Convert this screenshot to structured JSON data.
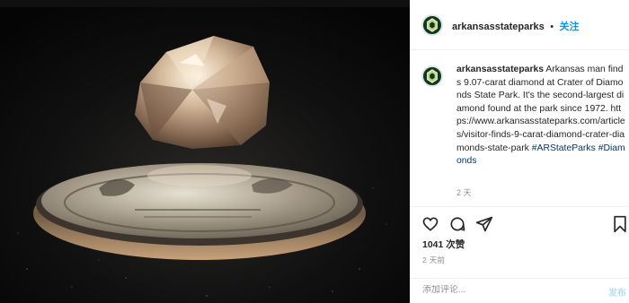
{
  "post": {
    "photo_alt": "Diamond on a coin",
    "header": {
      "username": "arkansasstateparks",
      "separator": "•",
      "follow_label": "关注"
    },
    "caption": {
      "username": "arkansasstateparks",
      "text": "Arkansas man finds 9.07-carat diamond at Crater of Diamonds State Park. It's the second-largest diamond found at the park since 1972. https://www.arkansasstateparks.com/articles/visitor-finds-9-carat-diamond-crater-diamonds-state-park",
      "hashtags": [
        "#ARStateParks",
        "#Diamonds"
      ],
      "time": "2 天"
    },
    "actions": {
      "icons": [
        "heart-icon",
        "comment-icon",
        "share-icon",
        "bookmark-icon"
      ]
    },
    "likes": "1041 次赞",
    "time_ago": "2 天前",
    "comment": {
      "placeholder": "添加评论...",
      "post_label": "发布"
    }
  }
}
